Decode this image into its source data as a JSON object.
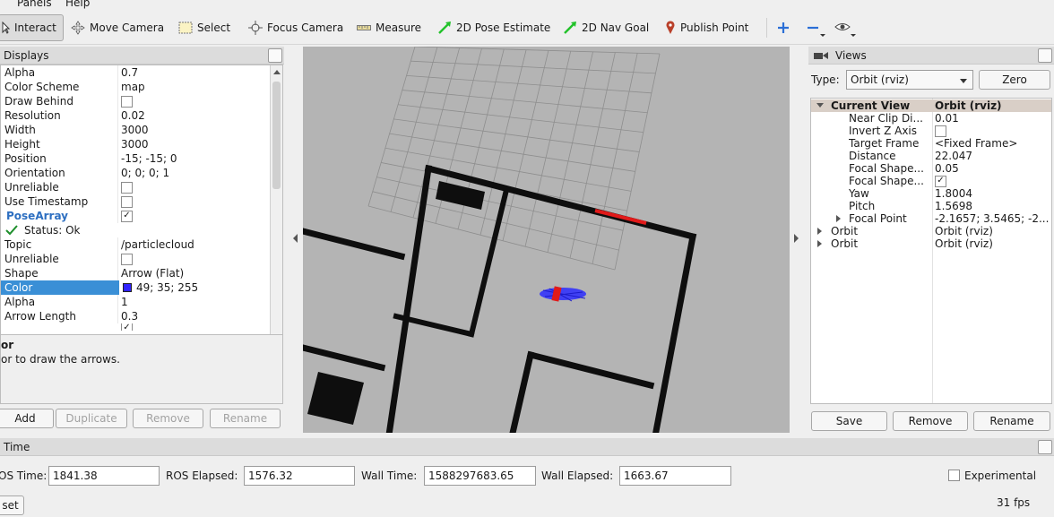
{
  "menubar": {
    "items": [
      "Panels",
      "Help"
    ]
  },
  "toolbar": {
    "tools": [
      {
        "label": "Interact",
        "icon": "interact-icon"
      },
      {
        "label": "Move Camera",
        "icon": "move-camera-icon"
      },
      {
        "label": "Select",
        "icon": "select-icon"
      },
      {
        "label": "Focus Camera",
        "icon": "focus-camera-icon"
      },
      {
        "label": "Measure",
        "icon": "ruler-icon"
      },
      {
        "label": "2D Pose Estimate",
        "icon": "green-arrow-icon"
      },
      {
        "label": "2D Nav Goal",
        "icon": "green-arrow-icon"
      },
      {
        "label": "Publish Point",
        "icon": "map-pin-icon"
      }
    ],
    "colors": {
      "pose_arrow": "#22c22a",
      "pin": "#b9402a",
      "plus": "#2b6fd6"
    }
  },
  "displays": {
    "title": "Displays",
    "rows": [
      {
        "name": "Alpha",
        "value": "0.7"
      },
      {
        "name": "Color Scheme",
        "value": "map"
      },
      {
        "name": "Draw Behind",
        "value": ""
      },
      {
        "name": "Resolution",
        "value": "0.02"
      },
      {
        "name": "Width",
        "value": "3000"
      },
      {
        "name": "Height",
        "value": "3000"
      },
      {
        "name": "Position",
        "value": "-15; -15; 0"
      },
      {
        "name": "Orientation",
        "value": "0; 0; 0; 1"
      },
      {
        "name": "Unreliable",
        "value": ""
      },
      {
        "name": "Use Timestamp",
        "value": ""
      },
      {
        "name": "PoseArray",
        "value": ""
      },
      {
        "name": "Status: Ok",
        "value": ""
      },
      {
        "name": "Topic",
        "value": "/particlecloud"
      },
      {
        "name": "Unreliable",
        "value": ""
      },
      {
        "name": "Shape",
        "value": "Arrow (Flat)"
      },
      {
        "name": "Color",
        "value": "49; 35; 255"
      },
      {
        "name": "Alpha",
        "value": "1"
      },
      {
        "name": "Arrow Length",
        "value": "0.3"
      }
    ],
    "description_title": "or",
    "description_text": "or to draw the arrows.",
    "buttons": {
      "add": "Add",
      "duplicate": "Duplicate",
      "remove": "Remove",
      "rename": "Rename"
    },
    "swatch_color": "#3123ff"
  },
  "views": {
    "title": "Views",
    "type_label": "Type:",
    "type_value": "Orbit (rviz)",
    "zero": "Zero",
    "current_view": {
      "name": "Current View",
      "value": "Orbit (rviz)"
    },
    "props": [
      {
        "name": "Near Clip Di...",
        "value": "0.01"
      },
      {
        "name": "Invert Z Axis",
        "value": ""
      },
      {
        "name": "Target Frame",
        "value": "<Fixed Frame>"
      },
      {
        "name": "Distance",
        "value": "22.047"
      },
      {
        "name": "Focal Shape...",
        "value": "0.05"
      },
      {
        "name": "Focal Shape...",
        "value": ""
      },
      {
        "name": "Yaw",
        "value": "1.8004"
      },
      {
        "name": "Pitch",
        "value": "1.5698"
      },
      {
        "name": "Focal Point",
        "value": "-2.1657; 3.5465; -2..."
      }
    ],
    "saved": [
      {
        "name": "Orbit",
        "value": "Orbit (rviz)"
      },
      {
        "name": "Orbit",
        "value": "Orbit (rviz)"
      }
    ],
    "buttons": {
      "save": "Save",
      "remove": "Remove",
      "rename": "Rename"
    }
  },
  "time": {
    "title": "Time",
    "ros_time_label": "OS Time:",
    "ros_time": "1841.38",
    "ros_elapsed_label": "ROS Elapsed:",
    "ros_elapsed": "1576.32",
    "wall_time_label": "Wall Time:",
    "wall_time": "1588297683.65",
    "wall_elapsed_label": "Wall Elapsed:",
    "wall_elapsed": "1663.67",
    "experimental": "Experimental",
    "reset": "set",
    "fps": "31 fps"
  },
  "viewport": {
    "background": "#b4b4b4",
    "wall_color": "#0e0e0e",
    "laser_color": "#e11a1a",
    "particle_color": "#2b2bff"
  }
}
